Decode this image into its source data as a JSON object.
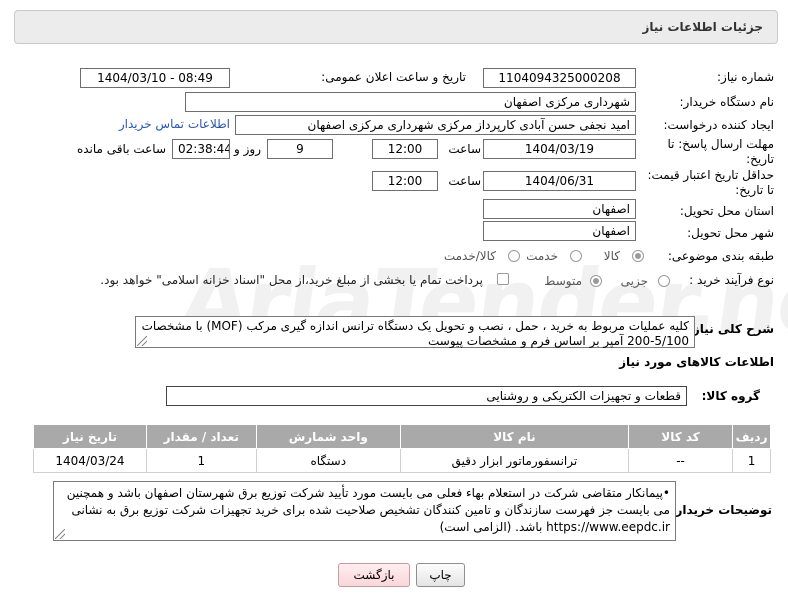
{
  "header": {
    "title": "جزئیات اطلاعات نیاز"
  },
  "need_number": {
    "label": "شماره نیاز:",
    "value": "1104094325000208"
  },
  "announce_datetime": {
    "label": "تاریخ و ساعت اعلان عمومی:",
    "value": "1404/03/10 - 08:49"
  },
  "buyer_org": {
    "label": "نام دستگاه خریدار:",
    "value": "شهرداری مرکزی اصفهان"
  },
  "requester": {
    "label": "ایجاد کننده درخواست:",
    "value": "امید نجفی حسن آبادی کارپرداز مرکزی شهرداری مرکزی اصفهان",
    "contact_link": "اطلاعات تماس خریدار"
  },
  "reply_deadline": {
    "label_line1": "مهلت ارسال پاسخ: تا",
    "label_line2": "تاریخ:",
    "date": "1404/03/19",
    "time_label": "ساعت",
    "time": "12:00",
    "days": "9",
    "days_label": "روز و",
    "remaining": "02:38:44",
    "remaining_label": "ساعت باقی مانده"
  },
  "price_validity": {
    "label_line1": "حداقل تاریخ اعتبار قیمت:",
    "label_line2": "تا تاریخ:",
    "date": "1404/06/31",
    "time_label": "ساعت",
    "time": "12:00"
  },
  "delivery_province": {
    "label": "استان محل تحویل:",
    "value": "اصفهان"
  },
  "delivery_city": {
    "label": "شهر محل تحویل:",
    "value": "اصفهان"
  },
  "category": {
    "label": "طبقه بندی موضوعی:",
    "options": [
      "کالا",
      "خدمت",
      "کالا/خدمت"
    ],
    "selected": "کالا"
  },
  "purchase_process": {
    "label": "نوع فرآیند خرید :",
    "options": [
      "جزیی",
      "متوسط"
    ],
    "selected": "متوسط",
    "payment_note": "پرداخت تمام یا بخشی از مبلغ خرید،از محل \"اسناد خزانه اسلامی\" خواهد بود."
  },
  "description": {
    "label": "شرح کلی نیاز:",
    "line1": "کلیه عملیات مربوط به خرید ، حمل ، نصب و تحویل یک دستگاه ترانس اندازه گیری مرکب (MOF) با مشخصات",
    "line2": "200-5/100 آمپر بر اساس فرم و مشخصات پیوست"
  },
  "goods_section": {
    "title": "اطلاعات کالاهای مورد نیاز"
  },
  "goods_group": {
    "label": "گروه کالا:",
    "value": "قطعات و تجهیزات الکتریکی و روشنایی"
  },
  "table": {
    "headers": [
      "ردیف",
      "کد کالا",
      "نام کالا",
      "واحد شمارش",
      "تعداد / مقدار",
      "تاریخ نیاز"
    ],
    "rows": [
      [
        "1",
        "--",
        "ترانسفورماتور ابزار دقیق",
        "دستگاه",
        "1",
        "1404/03/24"
      ]
    ]
  },
  "buyer_notes": {
    "label": "توضیحات خریدار:",
    "line1": "•پیمانکار متقاضی شرکت در استعلام بهاء فعلی می بایست مورد تأیید شرکت توزیع برق شهرستان اصفهان باشد و همچنین",
    "line2": "می بایست جز فهرست سازندگان و تامین کنندگان تشخیص صلاحیت شده برای خرید تجهیزات شرکت توزیع برق به نشانی",
    "line3": "https://www.eepdc.ir باشد. (الزامی است)"
  },
  "buttons": {
    "print": "چاپ",
    "back": "بازگشت"
  },
  "watermark": "AriaTender.neT"
}
